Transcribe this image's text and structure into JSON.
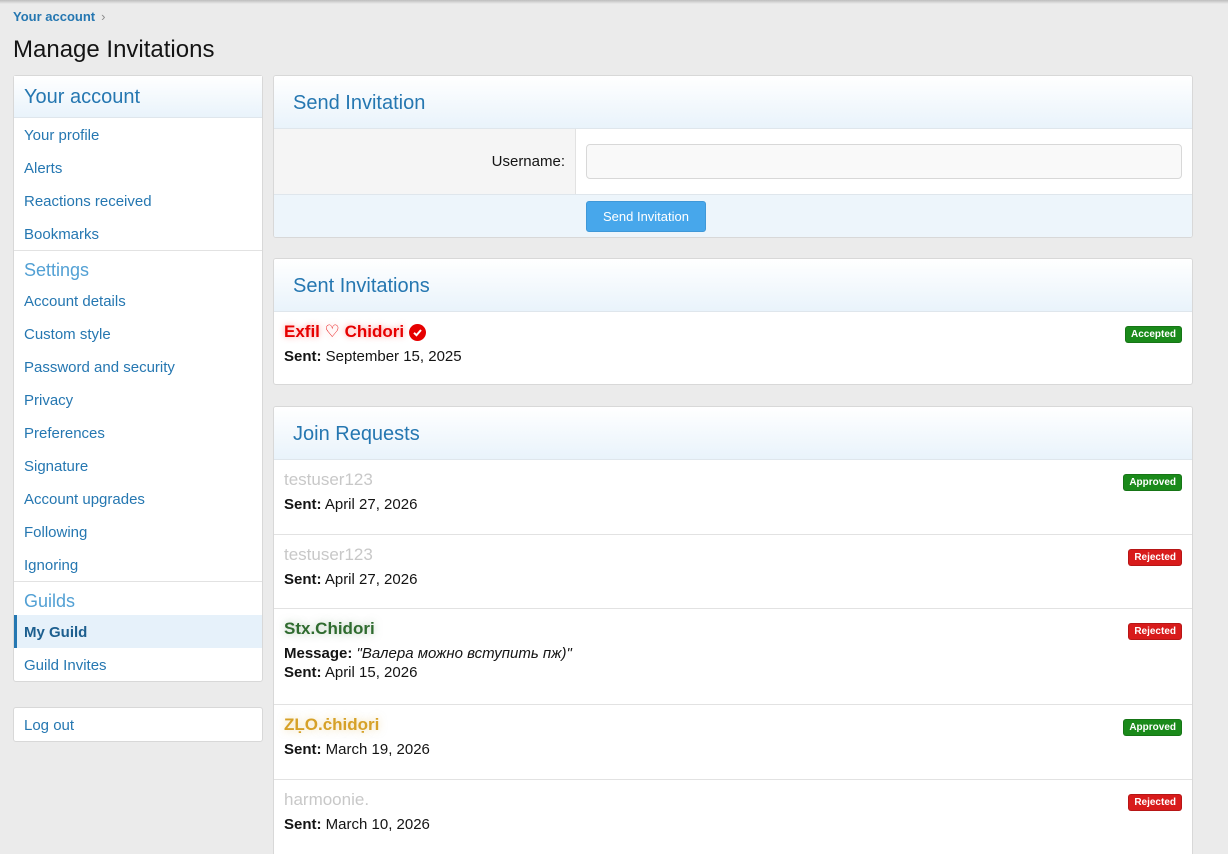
{
  "breadcrumb": {
    "label": "Your account"
  },
  "page": {
    "title": "Manage Invitations"
  },
  "sidebar": {
    "header": "Your account",
    "group1": [
      "Your profile",
      "Alerts",
      "Reactions received",
      "Bookmarks"
    ],
    "settings_title": "Settings",
    "group2": [
      "Account details",
      "Custom style",
      "Password and security",
      "Privacy",
      "Preferences",
      "Signature",
      "Account upgrades",
      "Following",
      "Ignoring"
    ],
    "guilds_title": "Guilds",
    "group3": [
      "My Guild",
      "Guild Invites"
    ],
    "logout": "Log out"
  },
  "send": {
    "title": "Send Invitation",
    "username_label": "Username:",
    "username_value": "",
    "button": "Send Invitation"
  },
  "sent": {
    "title": "Sent Invitations",
    "items": [
      {
        "name": "Exfil ♡ Chidori",
        "sent_label": "Sent:",
        "date": "September 15, 2025",
        "status": "Accepted"
      }
    ]
  },
  "requests": {
    "title": "Join Requests",
    "items": [
      {
        "name": "testuser123",
        "sent_label": "Sent:",
        "date": "April 27, 2026",
        "status": "Approved"
      },
      {
        "name": "testuser123",
        "sent_label": "Sent:",
        "date": "April 27, 2026",
        "status": "Rejected"
      },
      {
        "name": "Stx.Chidori",
        "message_label": "Message:",
        "message": "\"Валера можно вступить пж)\"",
        "sent_label": "Sent:",
        "date": "April 15, 2026",
        "status": "Rejected"
      },
      {
        "name": "ZḶO.ċhidọri",
        "sent_label": "Sent:",
        "date": "March 19, 2026",
        "status": "Approved"
      },
      {
        "name": "harmoonie.",
        "sent_label": "Sent:",
        "date": "March 10, 2026",
        "status": "Rejected"
      }
    ]
  }
}
